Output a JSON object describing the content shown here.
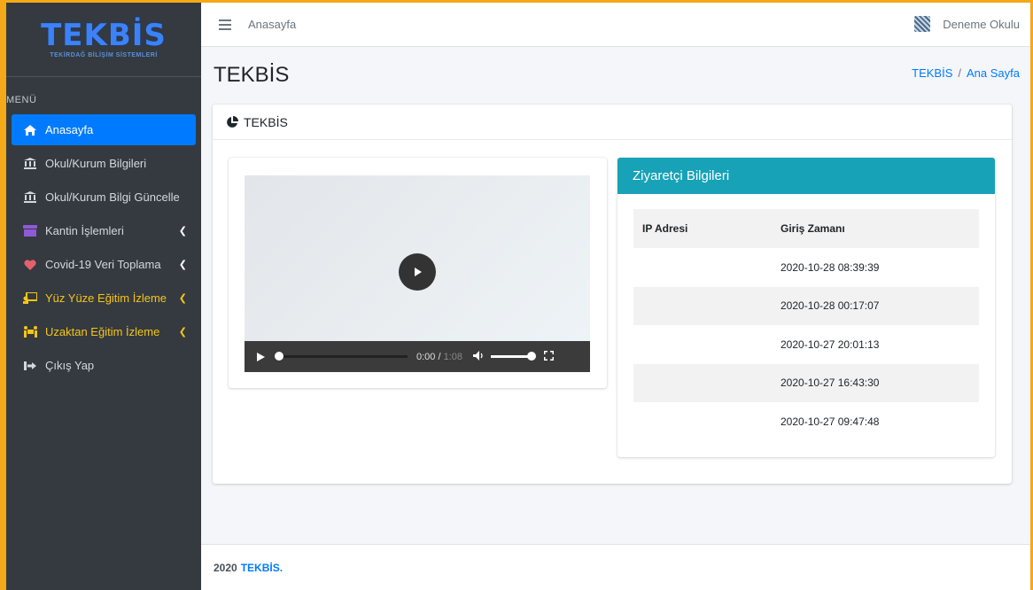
{
  "brand": {
    "logo_text": "TEKBİS",
    "logo_subtitle": "TEKİRDAĞ BİLİŞİM SİSTEMLERİ"
  },
  "sidebar": {
    "header": "MENÜ",
    "items": [
      {
        "label": "Anasayfa",
        "icon": "home-icon",
        "active": true
      },
      {
        "label": "Okul/Kurum Bilgileri",
        "icon": "institution-icon"
      },
      {
        "label": "Okul/Kurum Bilgi Güncelle",
        "icon": "institution-icon"
      },
      {
        "label": "Kantin İşlemleri",
        "icon": "store-icon",
        "has_children": true
      },
      {
        "label": "Covid-19 Veri Toplama",
        "icon": "heart-icon",
        "has_children": true
      },
      {
        "label": "Yüz Yüze Eğitim İzleme",
        "icon": "chalkboard-teacher-icon",
        "has_children": true
      },
      {
        "label": "Uzaktan Eğitim İzleme",
        "icon": "people-carry-icon",
        "has_children": true
      },
      {
        "label": "Çıkış Yap",
        "icon": "sign-out-icon"
      }
    ]
  },
  "topbar": {
    "home_link": "Anasayfa",
    "user_name": "Deneme Okulu"
  },
  "page": {
    "title": "TEKBİS",
    "breadcrumb": [
      "TEKBİS",
      "Ana Sayfa"
    ]
  },
  "main_card": {
    "title": "TEKBİS"
  },
  "video": {
    "current_time": "0:00",
    "duration": "1:08"
  },
  "visitor": {
    "title": "Ziyaretçi Bilgileri",
    "columns": [
      "IP Adresi",
      "Giriş Zamanı"
    ],
    "rows": [
      {
        "ip": "",
        "time": "2020-10-28 08:39:39"
      },
      {
        "ip": "",
        "time": "2020-10-28 00:17:07"
      },
      {
        "ip": "",
        "time": "2020-10-27 20:01:13"
      },
      {
        "ip": "",
        "time": "2020-10-27 16:43:30"
      },
      {
        "ip": "",
        "time": "2020-10-27 09:47:48"
      }
    ]
  },
  "footer": {
    "year": "2020",
    "brand": "TEKBİS."
  },
  "colors": {
    "sidebar_bg": "#343a40",
    "active": "#007bff",
    "info": "#17a2b8",
    "highlight": "#f5c518",
    "frame": "#f4a918"
  }
}
